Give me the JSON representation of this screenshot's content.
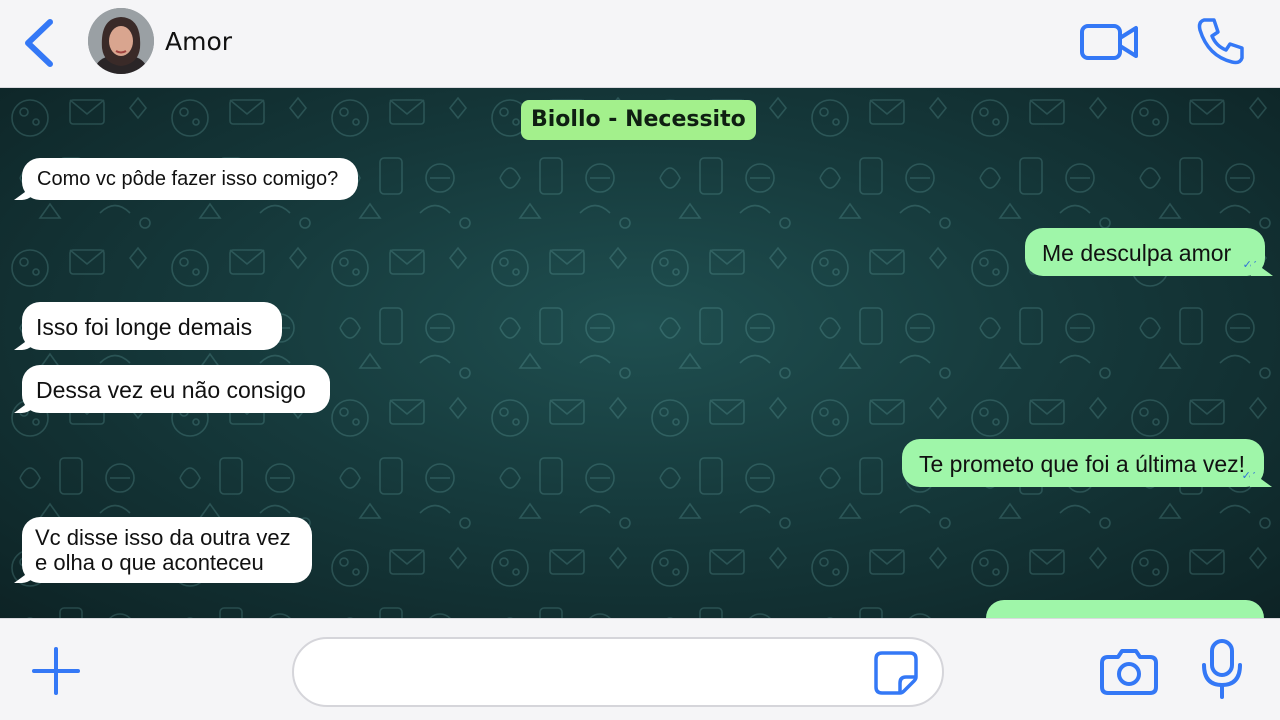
{
  "header": {
    "contact_name": "Amor",
    "back_icon": "chevron-left-icon",
    "video_icon": "video-camera-icon",
    "phone_icon": "phone-icon"
  },
  "chat": {
    "banner": "Biollo - Necessito",
    "messages": [
      {
        "direction": "incoming",
        "text": "Como vc pôde fazer isso comigo?"
      },
      {
        "direction": "outgoing",
        "text": "Me desculpa amor",
        "read": true
      },
      {
        "direction": "incoming",
        "text": "Isso foi longe demais"
      },
      {
        "direction": "incoming",
        "text": "Dessa vez eu não consigo"
      },
      {
        "direction": "outgoing",
        "text": "Te prometo que foi a última vez!",
        "read": true
      },
      {
        "direction": "incoming",
        "text": "Vc disse isso da outra vez e olha o que aconteceu"
      },
      {
        "direction": "outgoing",
        "text": ""
      }
    ],
    "read_ticks": "✓✓"
  },
  "composer": {
    "input_value": "",
    "input_placeholder": "",
    "plus_icon": "plus-icon",
    "sticker_icon": "sticker-icon",
    "camera_icon": "camera-icon",
    "mic_icon": "microphone-icon"
  },
  "colors": {
    "accent": "#3478f6",
    "outgoing_bubble": "#9ff6a9",
    "incoming_bubble": "#ffffff",
    "banner": "#a3f08c",
    "chat_background": "#163a3c"
  }
}
